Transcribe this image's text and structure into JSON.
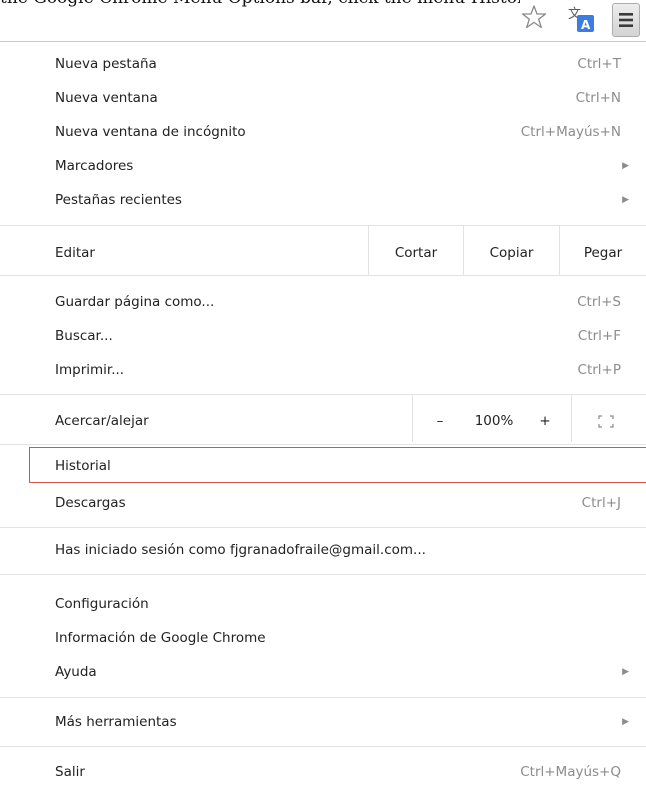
{
  "header_text": "the Google Chrome Menu Options bar, click the menu-History and the History Page opens.",
  "toolbar": {
    "icons": [
      "star-icon",
      "translate-icon",
      "menu-icon"
    ]
  },
  "menu": {
    "new_tab": {
      "label": "Nueva pestaña",
      "shortcut": "Ctrl+T"
    },
    "new_window": {
      "label": "Nueva ventana",
      "shortcut": "Ctrl+N"
    },
    "incognito": {
      "label": "Nueva ventana de incógnito",
      "shortcut": "Ctrl+Mayús+N"
    },
    "bookmarks": {
      "label": "Marcadores"
    },
    "recent_tabs": {
      "label": "Pestañas recientes"
    },
    "edit": {
      "label": "Editar",
      "cut": "Cortar",
      "copy": "Copiar",
      "paste": "Pegar"
    },
    "save_page": {
      "label": "Guardar página como...",
      "shortcut": "Ctrl+S"
    },
    "find": {
      "label": "Buscar...",
      "shortcut": "Ctrl+F"
    },
    "print": {
      "label": "Imprimir...",
      "shortcut": "Ctrl+P"
    },
    "zoom": {
      "label": "Acercar/alejar",
      "minus": "–",
      "value": "100%",
      "plus": "+"
    },
    "history": {
      "label": "Historial"
    },
    "downloads": {
      "label": "Descargas",
      "shortcut": "Ctrl+J"
    },
    "signed_in": {
      "label": "Has iniciado sesión como fjgranadofraile@gmail.com..."
    },
    "settings": {
      "label": "Configuración"
    },
    "about": {
      "label": "Información de Google Chrome"
    },
    "help": {
      "label": "Ayuda"
    },
    "more_tools": {
      "label": "Más herramientas"
    },
    "exit": {
      "label": "Salir",
      "shortcut": "Ctrl+Mayús+Q"
    }
  },
  "colors": {
    "highlight_border": "#d9534f",
    "separator": "#e3e3e3",
    "shortcut_text": "#8c8c8c"
  }
}
